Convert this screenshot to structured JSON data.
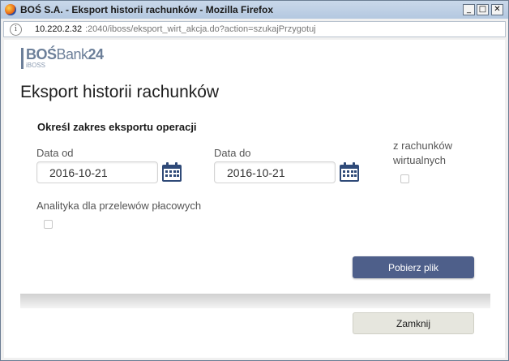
{
  "window": {
    "title": "BOŚ S.A. - Eksport historii rachunków - Mozilla Firefox",
    "controls": {
      "minimize": "_",
      "maximize": "□",
      "close": "✕"
    }
  },
  "urlbar": {
    "host": "10.220.2.32",
    "path": ":2040/iboss/eksport_wirt_akcja.do?action=szukajPrzygotuj"
  },
  "logo": {
    "bos": "BOŚ",
    "bank": "Bank",
    "num": "24",
    "sub": "iBOSS"
  },
  "page": {
    "title": "Eksport historii rachunków",
    "section_title": "Określ zakres eksportu operacji"
  },
  "form": {
    "date_from_label": "Data od",
    "date_from_value": "2016-10-21",
    "date_to_label": "Data do",
    "date_to_value": "2016-10-21",
    "virtual_label_line1": "z rachunków",
    "virtual_label_line2": "wirtualnych",
    "virtual_checked": false,
    "analytics_label": "Analityka dla przelewów płacowych",
    "analytics_checked": false
  },
  "buttons": {
    "download": "Pobierz plik",
    "close": "Zamknij"
  },
  "colors": {
    "primary_button": "#4e5f8a",
    "logo": "#6c7f99"
  }
}
